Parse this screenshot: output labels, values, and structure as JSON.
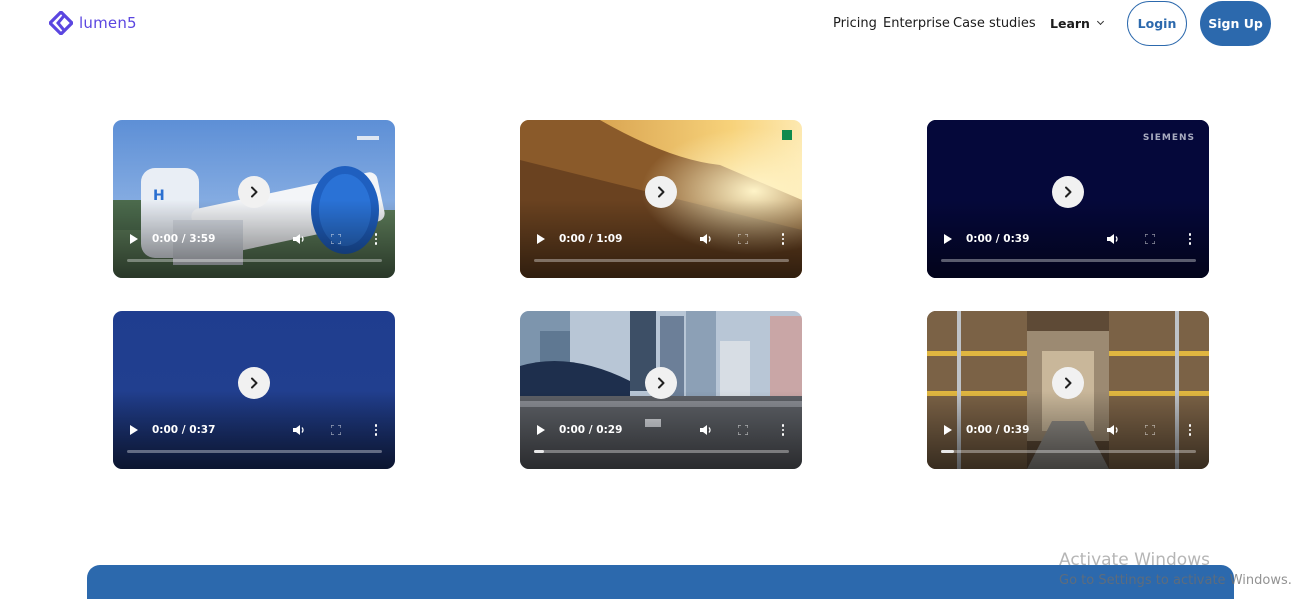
{
  "header": {
    "logo_text": "lumen5",
    "logo_icon": "lumen5-logo-icon",
    "nav": [
      {
        "label": "Pricing"
      },
      {
        "label": "Enterprise"
      },
      {
        "label": "Case studies"
      }
    ],
    "learn_label": "Learn",
    "login_label": "Login",
    "signup_label": "Sign Up"
  },
  "colors": {
    "brand_purple": "#5b46e0",
    "primary_blue": "#2c69ad"
  },
  "videos": [
    {
      "time": "0:00 / 3:59",
      "progress": 0,
      "scene": "hydrogen tanks"
    },
    {
      "time": "0:00 / 1:09",
      "progress": 0,
      "scene": "mountain sunrise"
    },
    {
      "time": "0:00 / 0:39",
      "progress": 0,
      "scene": "dark navy",
      "brand_text": "SIEMENS"
    },
    {
      "time": "0:00 / 0:37",
      "progress": 0,
      "scene": "blue gradient"
    },
    {
      "time": "0:00 / 0:29",
      "progress": 0.04,
      "scene": "city street"
    },
    {
      "time": "0:00 / 0:39",
      "progress": 0.05,
      "scene": "warehouse aisle"
    }
  ],
  "watermark": {
    "title": "Activate Windows",
    "subtitle": "Go to Settings to activate Windows."
  }
}
